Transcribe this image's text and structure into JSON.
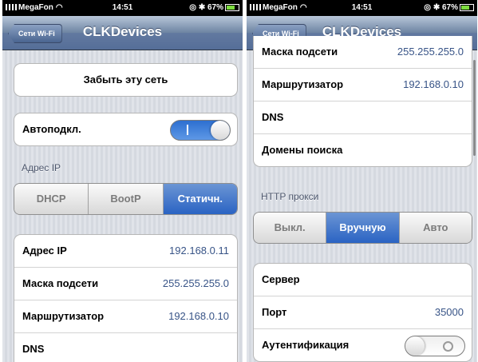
{
  "left": {
    "status": {
      "carrier": "MegaFon",
      "time": "14:51",
      "battery": "67%"
    },
    "nav": {
      "back": "Сети Wi-Fi",
      "title": "CLKDevices"
    },
    "forget": "Забыть эту сеть",
    "auto_join": {
      "label": "Автоподкл.",
      "on": true
    },
    "ip_section": "Адрес IP",
    "ip_modes": [
      "DHCP",
      "BootP",
      "Статичн."
    ],
    "rows": [
      {
        "label": "Адрес IP",
        "value": "192.168.0.11"
      },
      {
        "label": "Маска подсети",
        "value": "255.255.255.0"
      },
      {
        "label": "Маршрутизатор",
        "value": "192.168.0.10"
      },
      {
        "label": "DNS",
        "value": ""
      }
    ]
  },
  "right": {
    "status": {
      "carrier": "MegaFon",
      "time": "14:51",
      "battery": "67%"
    },
    "nav": {
      "back": "Сети Wi-Fi",
      "title": "CLKDevices"
    },
    "rows": [
      {
        "label": "Маска подсети",
        "value": "255.255.255.0"
      },
      {
        "label": "Маршрутизатор",
        "value": "192.168.0.10"
      },
      {
        "label": "DNS",
        "value": ""
      },
      {
        "label": "Домены поиска",
        "value": ""
      }
    ],
    "proxy_section": "HTTP прокси",
    "proxy_modes": [
      "Выкл.",
      "Вручную",
      "Авто"
    ],
    "proxy_rows": [
      {
        "label": "Сервер",
        "value": ""
      },
      {
        "label": "Порт",
        "value": "35000"
      },
      {
        "label": "Аутентификация",
        "value": ""
      }
    ]
  },
  "colors": {
    "accent": "#2a63c3",
    "value_text": "#385487",
    "nav": "#6d84a2"
  }
}
